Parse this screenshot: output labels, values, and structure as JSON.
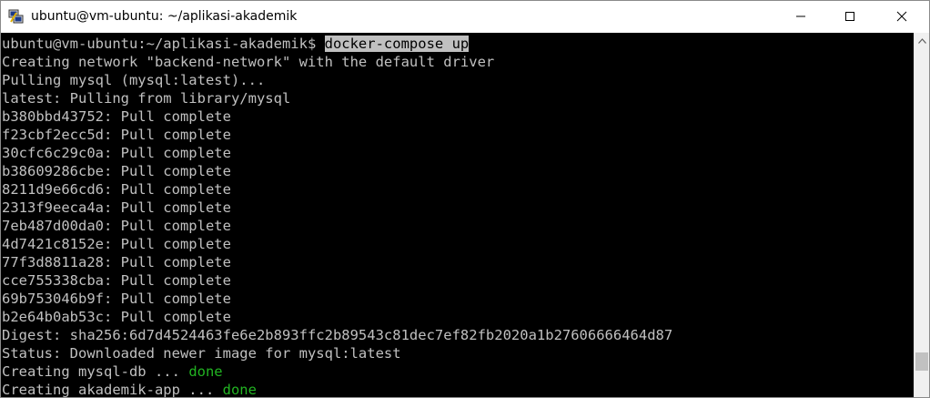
{
  "window": {
    "title": "ubuntu@vm-ubuntu: ~/aplikasi-akademik",
    "icon": "putty-icon"
  },
  "titlebar_buttons": {
    "minimize": "minimize-icon",
    "maximize": "maximize-icon",
    "close": "close-icon"
  },
  "terminal": {
    "prompt": "ubuntu@vm-ubuntu:~/aplikasi-akademik$ ",
    "command": "docker-compose up",
    "lines": [
      "Creating network \"backend-network\" with the default driver",
      "Pulling mysql (mysql:latest)...",
      "latest: Pulling from library/mysql",
      "b380bbd43752: Pull complete",
      "f23cbf2ecc5d: Pull complete",
      "30cfc6c29c0a: Pull complete",
      "b38609286cbe: Pull complete",
      "8211d9e66cd6: Pull complete",
      "2313f9eeca4a: Pull complete",
      "7eb487d00da0: Pull complete",
      "4d7421c8152e: Pull complete",
      "77f3d8811a28: Pull complete",
      "cce755338cba: Pull complete",
      "69b753046b9f: Pull complete",
      "b2e64b0ab53c: Pull complete",
      "Digest: sha256:6d7d4524463fe6e2b893ffc2b89543c81dec7ef82fb2020a1b27606666464d87",
      "Status: Downloaded newer image for mysql:latest"
    ],
    "status_lines": [
      {
        "text": "Creating mysql-db ... ",
        "status": "done"
      },
      {
        "text": "Creating akademik-app ... ",
        "status": "done"
      }
    ]
  },
  "colors": {
    "terminal_bg": "#000000",
    "terminal_fg": "#c0c0c0",
    "done_green": "#22b422",
    "selection_bg": "#c0c0c0"
  }
}
